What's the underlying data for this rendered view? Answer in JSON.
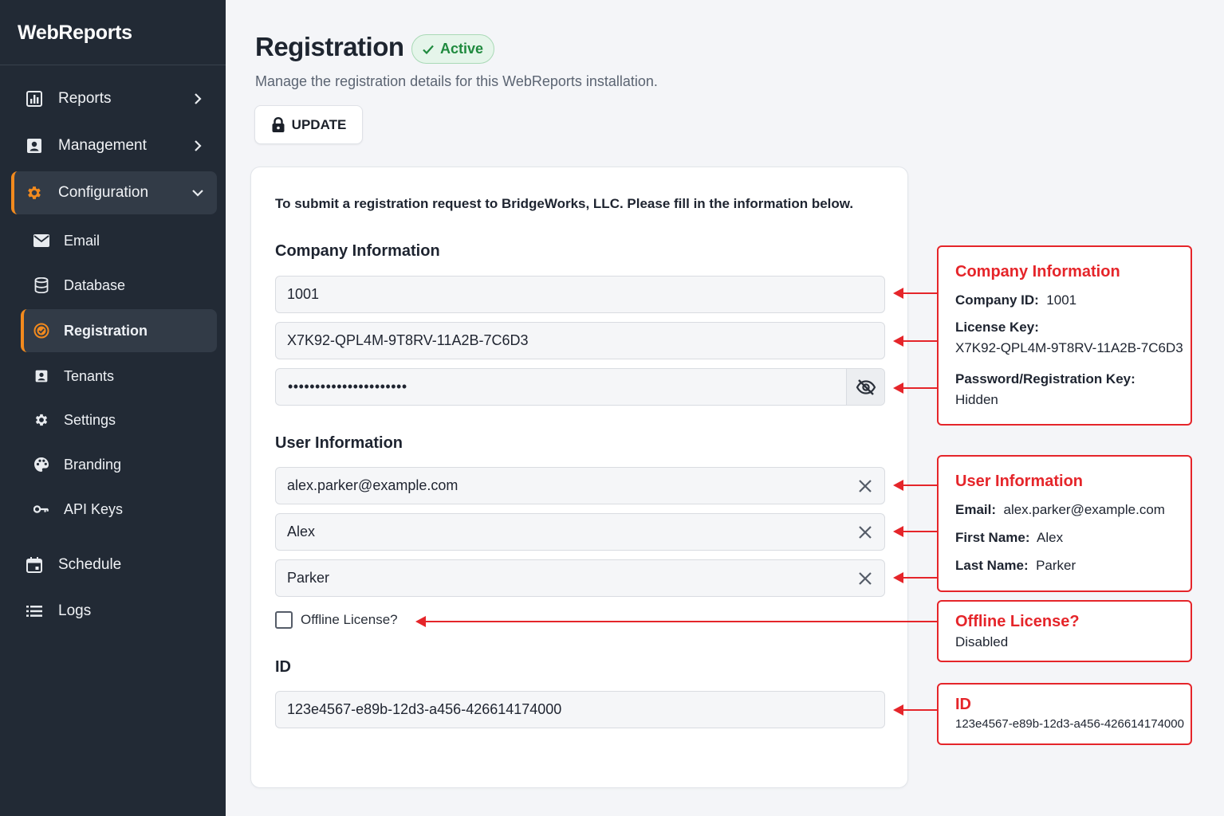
{
  "app": {
    "name": "WebReports"
  },
  "sidebar": {
    "items": [
      {
        "label": "Reports",
        "icon": "bar-chart-icon"
      },
      {
        "label": "Management",
        "icon": "id-badge-icon"
      },
      {
        "label": "Configuration",
        "icon": "gear-icon",
        "expanded": true
      },
      {
        "label": "Schedule",
        "icon": "calendar-icon"
      },
      {
        "label": "Logs",
        "icon": "list-icon"
      }
    ],
    "sub_items": [
      {
        "label": "Email",
        "icon": "envelope-icon"
      },
      {
        "label": "Database",
        "icon": "database-icon"
      },
      {
        "label": "Registration",
        "icon": "check-circle-icon",
        "active": true
      },
      {
        "label": "Tenants",
        "icon": "id-badge-icon"
      },
      {
        "label": "Settings",
        "icon": "gear-icon"
      },
      {
        "label": "Branding",
        "icon": "palette-icon"
      },
      {
        "label": "API Keys",
        "icon": "key-icon"
      }
    ]
  },
  "header": {
    "title": "Registration",
    "status": "Active",
    "subtitle": "Manage the registration details for this WebReports installation.",
    "update_label": "UPDATE"
  },
  "form": {
    "intro": "To submit a registration request to BridgeWorks, LLC. Please fill in the information below.",
    "company_title": "Company Information",
    "company_id": "1001",
    "license_key": "X7K92-QPL4M-9T8RV-11A2B-7C6D3",
    "password_mask": "••••••••••••••••••••••",
    "user_title": "User Information",
    "email": "alex.parker@example.com",
    "first_name": "Alex",
    "last_name": "Parker",
    "offline_label": "Offline License?",
    "offline_checked": false,
    "id_title": "ID",
    "id_value": "123e4567-e89b-12d3-a456-426614174000"
  },
  "annotations": {
    "company": {
      "title": "Company Information",
      "company_id_label": "Company ID:",
      "company_id": "1001",
      "license_key_label": "License Key:",
      "license_key": "X7K92-QPL4M-9T8RV-11A2B-7C6D3",
      "password_label": "Password/Registration Key:",
      "password_value": "Hidden"
    },
    "user": {
      "title": "User Information",
      "email_label": "Email:",
      "email": "alex.parker@example.com",
      "first_name_label": "First Name:",
      "first_name": "Alex",
      "last_name_label": "Last Name:",
      "last_name": "Parker"
    },
    "offline": {
      "title": "Offline License?",
      "value": "Disabled"
    },
    "id": {
      "title": "ID",
      "value": "123e4567-e89b-12d3-a456-426614174000"
    }
  },
  "colors": {
    "sidebar_bg": "#222a35",
    "accent": "#f28a1e",
    "active_badge": "#1f8a3e",
    "annotation_red": "#e5252a"
  }
}
